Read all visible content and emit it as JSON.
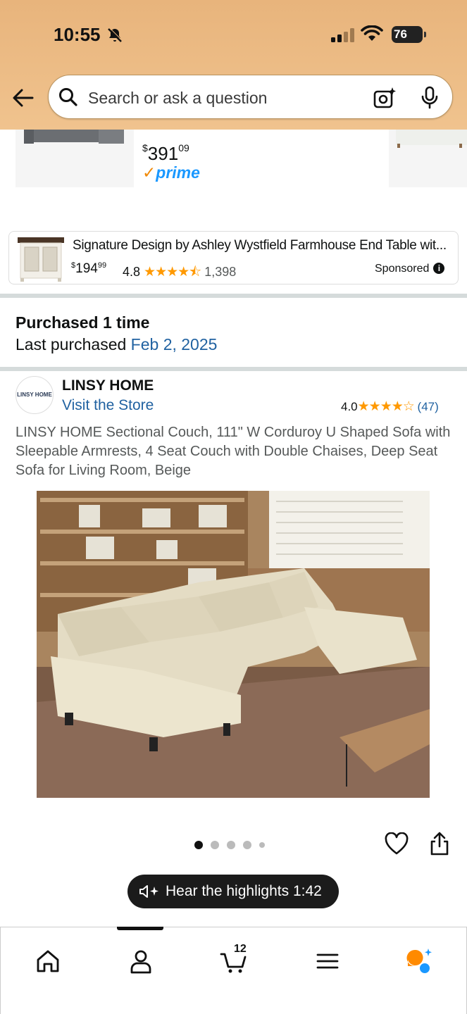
{
  "status_bar": {
    "time": "10:55",
    "battery": "76"
  },
  "search": {
    "placeholder": "Search or ask a question"
  },
  "carousel": {
    "price_whole": "391",
    "price_fraction": "09",
    "prime_label": "prime"
  },
  "ad": {
    "title": "Signature Design by Ashley Wystfield Farmhouse End Table wit...",
    "price_whole": "194",
    "price_fraction": "99",
    "currency": "$",
    "rating": "4.8",
    "rating_count": "1,398",
    "sponsored_label": "Sponsored"
  },
  "purchase": {
    "purchased_label": "Purchased 1 time",
    "last_label": "Last purchased",
    "last_date": "Feb 2, 2025"
  },
  "store": {
    "logo_text": "LINSY HOME",
    "brand": "LINSY HOME",
    "visit_label": "Visit the Store",
    "rating": "4.0",
    "rating_count": "(47)"
  },
  "product": {
    "title": "LINSY HOME Sectional Couch, 111\" W Corduroy U Shaped Sofa with Sleepable Armrests, 4 Seat Couch with Double Chaises, Deep Seat Sofa for Living Room, Beige",
    "image_count": 5,
    "active_image": 1
  },
  "highlights": {
    "label": "Hear the highlights 1:42"
  },
  "nav": {
    "cart_count": "12",
    "active": "account"
  },
  "colors": {
    "header": "#f0c38e",
    "link": "#2162a1",
    "star": "#ff9900",
    "prime": "#1a98ff"
  }
}
